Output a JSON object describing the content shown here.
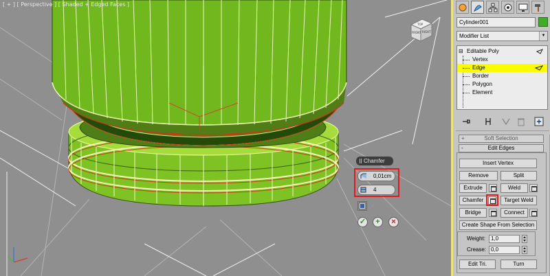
{
  "viewport": {
    "label": "[ + ] [ Perspective ] [ Shaded + Edged Faces ]",
    "viewcube_face_top": "TOP",
    "viewcube_face_front": "FRONT",
    "viewcube_face_right": "RIGHT"
  },
  "caddy": {
    "title": "Chamfer",
    "amount": "0,01cm",
    "segments": "4",
    "ok_icon": "check-icon",
    "apply_icon": "plus-icon",
    "cancel_icon": "x-icon"
  },
  "panel": {
    "tabs": [
      "create",
      "modify",
      "hierarchy",
      "motion",
      "display",
      "utilities"
    ],
    "object_name": "Cylinder001",
    "object_color": "#3eac26",
    "modifier_list": "Modifier List",
    "stack": {
      "root": "Editable Poly",
      "items": [
        "Vertex",
        "Edge",
        "Border",
        "Polygon",
        "Element"
      ],
      "selected": "Edge"
    },
    "soft_selection": "Soft Selection",
    "edit_edges": {
      "title": "Edit Edges",
      "insert_vertex": "Insert Vertex",
      "remove": "Remove",
      "split": "Split",
      "extrude": "Extrude",
      "weld": "Weld",
      "chamfer": "Chamfer",
      "target_weld": "Target Weld",
      "bridge": "Bridge",
      "connect": "Connect",
      "create_shape": "Create Shape From Selection",
      "weight_label": "Weight:",
      "weight_value": "1,0",
      "crease_label": "Crease:",
      "crease_value": "0,0",
      "edit_tri": "Edit Tri.",
      "turn": "Turn"
    },
    "accent_color": "#ede47b",
    "highlight_color": "#e0191b"
  }
}
